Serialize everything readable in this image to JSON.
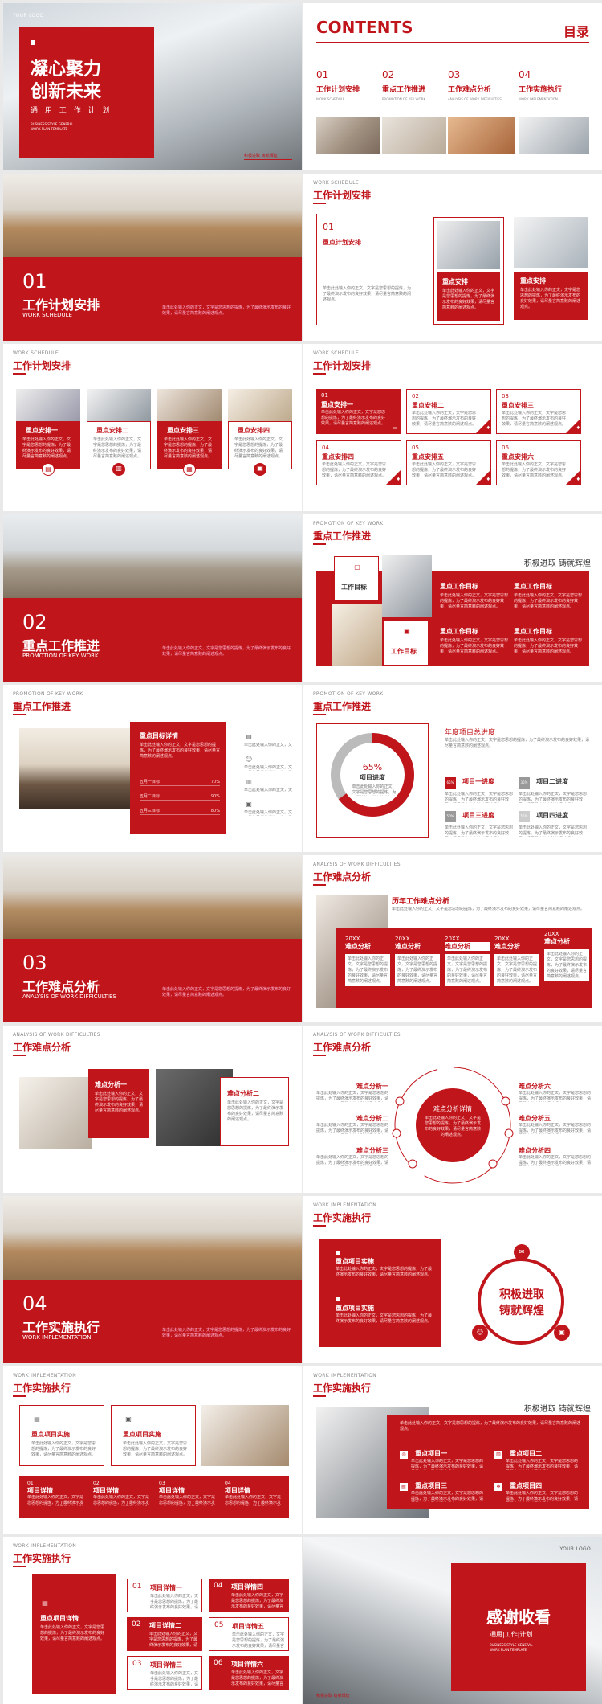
{
  "colors": {
    "accent": "#c0151b"
  },
  "s1": {
    "logo": "YOUR LOGO",
    "title1": "凝心聚力",
    "title2": "创新未来",
    "subtitle": "通 用 工 作 计 划",
    "en1": "BUSINESS STYLE GENERAL",
    "en2": "WORK PLAN TEMPLATE",
    "bottom": "积极进取 铸就辉煌"
  },
  "s2": {
    "title": "CONTENTS",
    "title_cn": "目录",
    "items": [
      {
        "num": "01",
        "cn": "工作计划安排",
        "en": "WORK SCHEDULE"
      },
      {
        "num": "02",
        "cn": "重点工作推进",
        "en": "PROMOTION OF KEY WORK"
      },
      {
        "num": "03",
        "cn": "工作难点分析",
        "en": "ANALYSIS OF WORK DIFFICULTIES"
      },
      {
        "num": "04",
        "cn": "工作实施执行",
        "en": "WORK IMPLEMENTATION"
      }
    ]
  },
  "s3": {
    "num": "01",
    "cn": "工作计划安排",
    "en": "WORK SCHEDULE"
  },
  "s4": {
    "tag": "WORK SCHEDULE",
    "title": "工作计划安排",
    "num": "01",
    "sub": "重点计划安排",
    "card1": "重点安排",
    "card2": "重点安排"
  },
  "s5": {
    "tag": "WORK SCHEDULE",
    "title": "工作计划安排",
    "items": [
      "重点安排一",
      "重点安排二",
      "重点安排三",
      "重点安排四"
    ]
  },
  "s6": {
    "tag": "WORK SCHEDULE",
    "title": "工作计划安排",
    "items": [
      {
        "num": "01",
        "label": "重点安排一"
      },
      {
        "num": "02",
        "label": "重点安排二"
      },
      {
        "num": "03",
        "label": "重点安排三"
      },
      {
        "num": "04",
        "label": "重点安排四"
      },
      {
        "num": "05",
        "label": "重点安排五"
      },
      {
        "num": "06",
        "label": "重点安排六"
      }
    ]
  },
  "s7": {
    "num": "02",
    "cn": "重点工作推进",
    "en": "PROMOTION OF KEY WORK"
  },
  "s8": {
    "tag": "PROMOTION OF KEY WORK",
    "title": "重点工作推进",
    "slogan": "积极进取 铸就辉煌",
    "goal1": "工作目标",
    "goal2": "工作目标",
    "items": [
      "重点工作目标",
      "重点工作目标",
      "重点工作目标",
      "重点工作目标"
    ]
  },
  "s9": {
    "tag": "PROMOTION OF KEY WORK",
    "title": "重点工作推进",
    "box": "重点目标详情",
    "rows": [
      {
        "label": "五月一目标",
        "value": "70%"
      },
      {
        "label": "五月二目标",
        "value": "90%"
      },
      {
        "label": "五月三目标",
        "value": "80%"
      }
    ]
  },
  "s10": {
    "tag": "PROMOTION OF KEY WORK",
    "title": "重点工作推进",
    "pct": "65%",
    "progress_label": "项目进度",
    "progress": 0.65,
    "heading": "年度项目总进度",
    "items": [
      {
        "pct": "65%",
        "label": "项目一进度"
      },
      {
        "pct": "35%",
        "label": "项目二进度"
      },
      {
        "pct": "50%",
        "label": "项目三进度"
      },
      {
        "pct": "55%",
        "label": "项目四进度"
      }
    ]
  },
  "s11": {
    "num": "03",
    "cn": "工作难点分析",
    "en": "ANALYSIS OF WORK DIFFICULTIES"
  },
  "s12": {
    "tag": "ANALYSIS OF WORK DIFFICULTIES",
    "title": "工作难点分析",
    "heading": "历年工作难点分析",
    "years": [
      "20XX",
      "20XX",
      "20XX",
      "20XX",
      "20XX"
    ],
    "label": "难点分析"
  },
  "s13": {
    "tag": "ANALYSIS OF WORK DIFFICULTIES",
    "title": "工作难点分析",
    "a1": "难点分析一",
    "a2": "难点分析二"
  },
  "s14": {
    "tag": "ANALYSIS OF WORK DIFFICULTIES",
    "title": "工作难点分析",
    "center": "难点分析详情",
    "left": [
      "难点分析一",
      "难点分析二",
      "难点分析三"
    ],
    "right": [
      "难点分析六",
      "难点分析五",
      "难点分析四"
    ]
  },
  "s15": {
    "num": "04",
    "cn": "工作实施执行",
    "en": "WORK IMPLEMENTATION"
  },
  "s16": {
    "tag": "WORK IMPLEMENTATION",
    "title": "工作实施执行",
    "b1": "重点项目实施",
    "b2": "重点项目实施",
    "slogan1": "积极进取",
    "slogan2": "铸就辉煌"
  },
  "s17": {
    "tag": "WORK IMPLEMENTATION",
    "title": "工作实施执行",
    "c1": "重点项目实施",
    "c2": "重点项目实施",
    "items": [
      {
        "num": "01",
        "label": "项目详情"
      },
      {
        "num": "02",
        "label": "项目详情"
      },
      {
        "num": "03",
        "label": "项目详情"
      },
      {
        "num": "04",
        "label": "项目详情"
      }
    ]
  },
  "s18": {
    "tag": "WORK IMPLEMENTATION",
    "title": "工作实施执行",
    "slogan": "积极进取 铸就辉煌",
    "items": [
      "重点项目一",
      "重点项目二",
      "重点项目三",
      "重点项目四"
    ]
  },
  "s19": {
    "tag": "WORK IMPLEMENTATION",
    "title": "工作实施执行",
    "box": "重点项目详情",
    "items": [
      {
        "num": "01",
        "label": "项目详情一"
      },
      {
        "num": "04",
        "label": "项目详情四"
      },
      {
        "num": "02",
        "label": "项目详情二"
      },
      {
        "num": "05",
        "label": "项目详情五"
      },
      {
        "num": "03",
        "label": "项目详情三"
      },
      {
        "num": "06",
        "label": "项目详情六"
      }
    ]
  },
  "s20": {
    "logo": "YOUR LOGO",
    "thanks": "感谢收看",
    "sub": "通用|工作|计划",
    "en1": "BUSINESS STYLE GENERAL",
    "en2": "WORK PLAN TEMPLATE",
    "bottom": "积极进取 铸就辉煌"
  },
  "body_text": "单击此处输入你的正文，文字是您思想的提炼，为了最终演示发布的良好效果，请尽量言简意赅的阐述观点。"
}
